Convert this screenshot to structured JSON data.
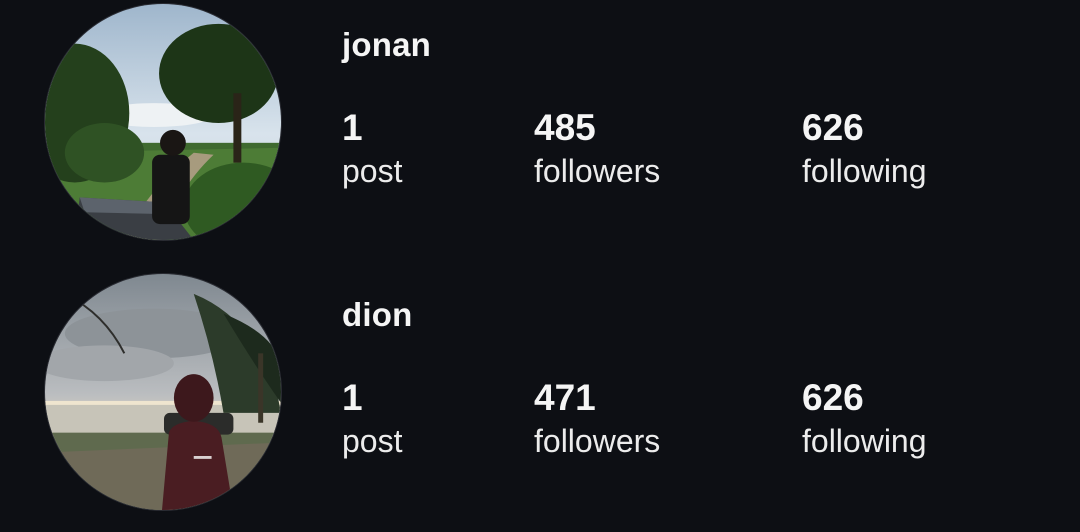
{
  "profiles": [
    {
      "username": "jonan",
      "stats": {
        "posts": {
          "value": "1",
          "label": "post"
        },
        "followers": {
          "value": "485",
          "label": "followers"
        },
        "following": {
          "value": "626",
          "label": "following"
        }
      }
    },
    {
      "username": "dion",
      "stats": {
        "posts": {
          "value": "1",
          "label": "post"
        },
        "followers": {
          "value": "471",
          "label": "followers"
        },
        "following": {
          "value": "626",
          "label": "following"
        }
      }
    }
  ]
}
